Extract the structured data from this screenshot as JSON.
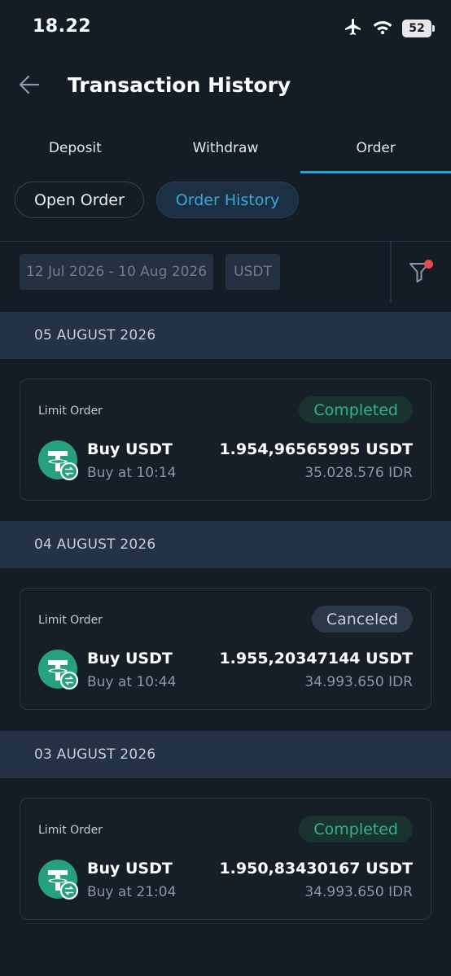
{
  "status_bar": {
    "time": "18.22",
    "battery": "52",
    "icons": [
      "airplane-icon",
      "wifi-icon",
      "battery-icon"
    ]
  },
  "header": {
    "title": "Transaction History",
    "back_icon": "arrow-left-icon"
  },
  "tabs": [
    {
      "label": "Deposit",
      "active": false
    },
    {
      "label": "Withdraw",
      "active": false
    },
    {
      "label": "Order",
      "active": true
    }
  ],
  "order_tabs": [
    {
      "label": "Open Order",
      "active": false
    },
    {
      "label": "Order History",
      "active": true
    }
  ],
  "filters": {
    "date_range": "12 Jul 2026 - 10 Aug 2026",
    "coin": "USDT",
    "filter_icon": "funnel-icon"
  },
  "groups": [
    {
      "date": "05 AUGUST 2026",
      "order": {
        "type": "Limit Order",
        "status": "Completed",
        "title": "Buy USDT",
        "time": "Buy at 10:14",
        "amount": "1.954,96565995 USDT",
        "fiat": "35.028.576 IDR"
      }
    },
    {
      "date": "04 AUGUST 2026",
      "order": {
        "type": "Limit Order",
        "status": "Canceled",
        "title": "Buy USDT",
        "time": "Buy at 10:44",
        "amount": "1.955,20347144 USDT",
        "fiat": "34.993.650 IDR"
      }
    },
    {
      "date": "03 AUGUST 2026",
      "order": {
        "type": "Limit Order",
        "status": "Completed",
        "title": "Buy USDT",
        "time": "Buy at 21:04",
        "amount": "1.950,83430167 USDT",
        "fiat": "34.993.650 IDR"
      }
    }
  ],
  "colors": {
    "background": "#141c25",
    "accent": "#27a5d8",
    "completed": "#33b389",
    "tether": "#26a17b",
    "alert_dot": "#e5484d"
  }
}
